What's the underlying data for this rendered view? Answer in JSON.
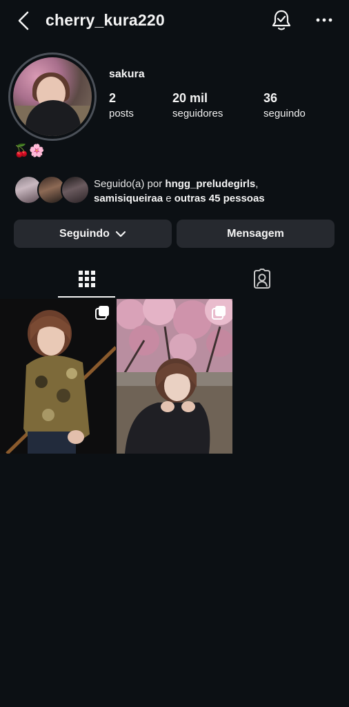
{
  "header": {
    "username": "cherry_kura220",
    "back_icon": "chevron-left-icon",
    "notify_icon": "bell-check-icon",
    "more_icon": "more-horizontal-icon"
  },
  "profile": {
    "display_name": "sakura",
    "bio": "🍒🌸",
    "stats": [
      {
        "value": "2",
        "label": "posts"
      },
      {
        "value": "20 mil",
        "label": "seguidores"
      },
      {
        "value": "36",
        "label": "seguindo"
      }
    ],
    "followed_by": {
      "prefix": "Seguido(a) por ",
      "user1": "hngg_preludegirls",
      "sep1": ",",
      "user2": "samisiqueiraa",
      "sep2": " e ",
      "others": "outras 45 pessoas"
    }
  },
  "actions": {
    "following_label": "Seguindo",
    "message_label": "Mensagem"
  },
  "tabs": [
    {
      "name": "posts-grid",
      "icon": "grid-icon",
      "active": true
    },
    {
      "name": "tagged",
      "icon": "tagged-user-icon",
      "active": false
    }
  ],
  "colors": {
    "background": "#0c1014",
    "button": "#26292f",
    "text": "#f5f5f5"
  }
}
